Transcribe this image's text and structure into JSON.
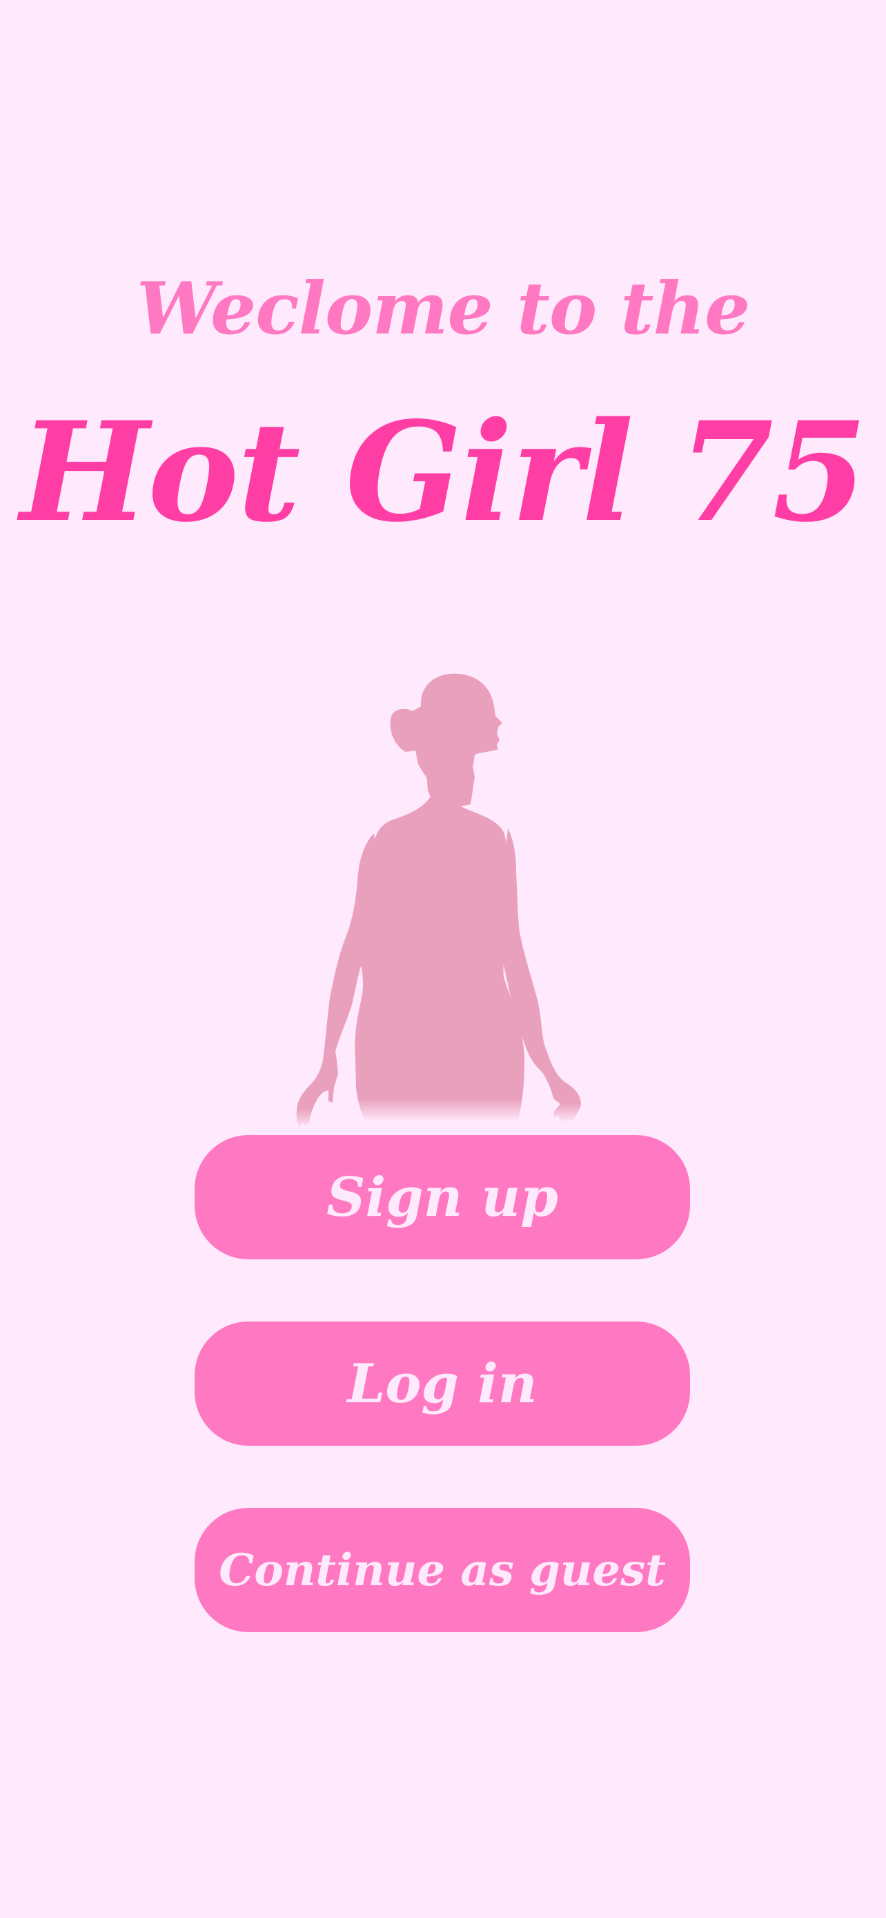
{
  "header": {
    "welcome_text": "Weclome to the",
    "app_title": "Hot Girl 75"
  },
  "hero": {
    "image_name": "woman-silhouette",
    "color": "#E9A0BC"
  },
  "actions": {
    "sign_up_label": "Sign up",
    "log_in_label": "Log in",
    "guest_label": "Continue as guest"
  },
  "colors": {
    "background": "#FFEAFD",
    "title": "#FF3EA5",
    "welcome": "#FF78C2",
    "button": "#FF78C2",
    "button_text": "#FFEAFD"
  }
}
